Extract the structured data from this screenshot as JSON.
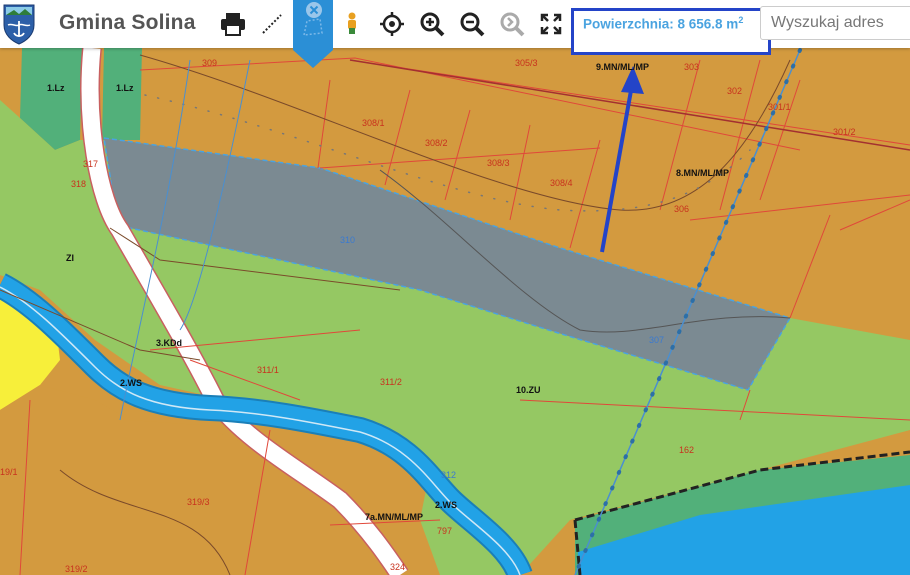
{
  "app": {
    "title": "Gmina Solina"
  },
  "toolbar": {
    "print": "print-icon",
    "measure_distance": "measure-line-icon",
    "measure_area": "measure-area-icon",
    "close_measure": "close-icon",
    "person": "street-view-icon",
    "locate": "crosshair-icon",
    "zoom_in": "zoom-in-icon",
    "zoom_out": "zoom-out-icon",
    "zoom_next": "zoom-next-icon",
    "fullscreen": "fullscreen-icon"
  },
  "measurement": {
    "label": "Powierzchnia: 8 656.8 m",
    "unit_sup": "2"
  },
  "search": {
    "placeholder": "Wyszukaj adres"
  },
  "colors": {
    "residential": "#d39a3f",
    "green": "#95c863",
    "dark_green": "#52b07a",
    "water": "#22a2e6",
    "yellow": "#f7ef3a",
    "selection": "#7b8a92",
    "accent": "#2b8fd6",
    "annotation": "#2444c8"
  },
  "map_labels": {
    "l309": "309",
    "l305_3": "305/3",
    "l9mn": "9.MN/ML/MP",
    "l303": "303",
    "l302": "302",
    "l301_1": "301/1",
    "l301_2": "301/2",
    "l1lz_a": "1.Lz",
    "l1lz_b": "1.Lz",
    "l308_1": "308/1",
    "l308_2": "308/2",
    "l308_3": "308/3",
    "l308_4": "308/4",
    "l317": "317",
    "l318": "318",
    "l8mn": "8.MN/ML/MP",
    "l306": "306",
    "l310": "310",
    "lzi": "ZI",
    "l307": "307",
    "l3kdd": "3.KDd",
    "l311_1": "311/1",
    "l311_2": "311/2",
    "l2ws_a": "2.WS",
    "l10zu": "10.ZU",
    "l162": "162",
    "l312": "312",
    "l2ws_b": "2.WS",
    "l319_3": "319/3",
    "l319_1": "19/1",
    "l7a": "7a.MN/ML/MP",
    "l797": "797",
    "l319_2": "319/2",
    "l324": "324"
  }
}
